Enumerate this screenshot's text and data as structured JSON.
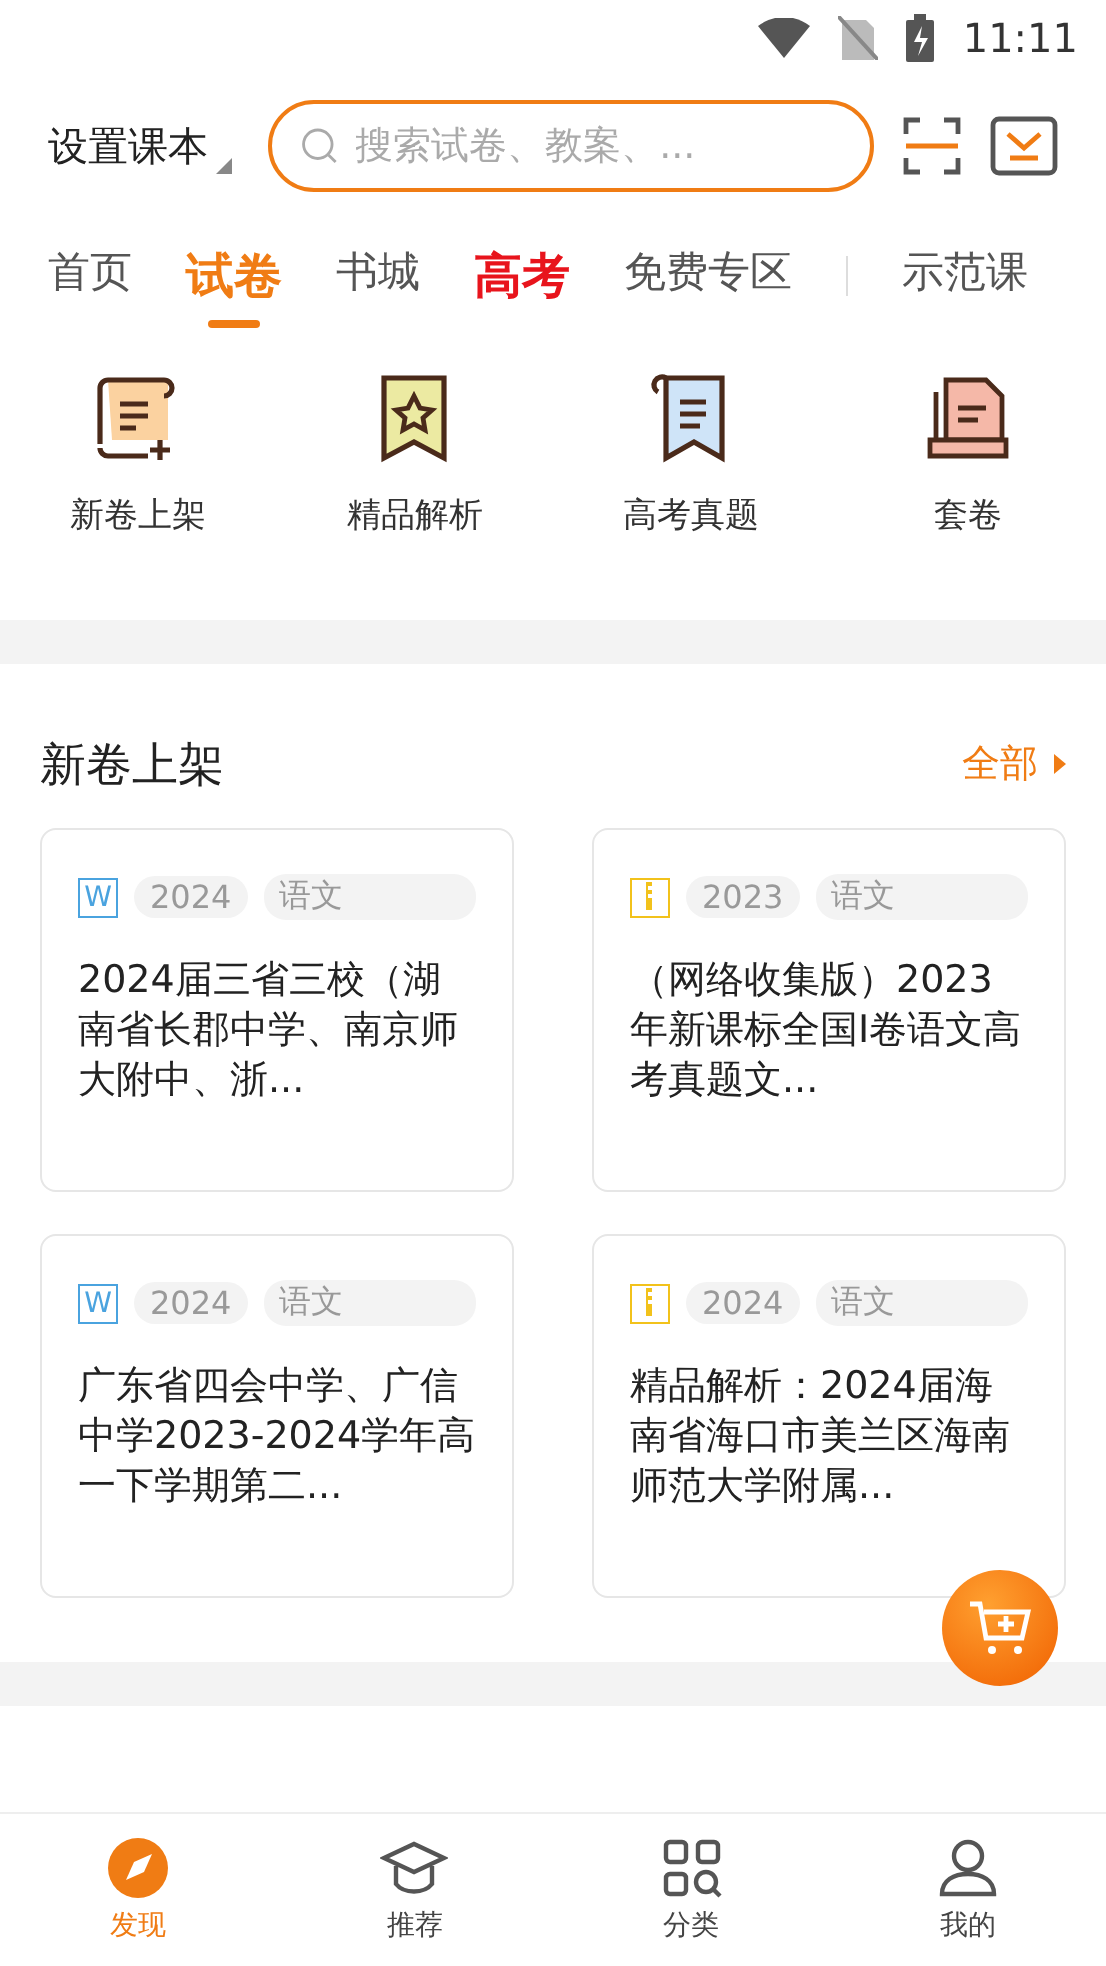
{
  "status_bar": {
    "time": "11:11"
  },
  "header": {
    "textbook": "设置课本",
    "search": {
      "placeholder": "搜索试卷、教案、..."
    }
  },
  "tabs": [
    {
      "label": "首页",
      "selected": false,
      "emphasis": false
    },
    {
      "label": "试卷",
      "selected": true,
      "emphasis": false
    },
    {
      "label": "书城",
      "selected": false,
      "emphasis": false
    },
    {
      "label": "高考",
      "selected": false,
      "emphasis": true
    },
    {
      "label": "免费专区",
      "selected": false,
      "emphasis": false
    },
    {
      "label": "示范课",
      "selected": false,
      "emphasis": false
    }
  ],
  "shortcuts": [
    {
      "label": "新卷上架",
      "kind": "new"
    },
    {
      "label": "精品解析",
      "kind": "star"
    },
    {
      "label": "高考真题",
      "kind": "exam"
    },
    {
      "label": "套卷",
      "kind": "set"
    }
  ],
  "sections": [
    {
      "title": "新卷上架",
      "more": "全部",
      "cards": [
        {
          "kind": "word",
          "file_badge": "W",
          "year": "2024",
          "subject": "语文",
          "title": "2024届三省三校（湖南省长郡中学、南京师大附中、浙..."
        },
        {
          "kind": "zip",
          "year": "2023",
          "subject": "语文",
          "title": "（网络收集版）2023年新课标全国I卷语文高考真题文..."
        },
        {
          "kind": "word",
          "file_badge": "W",
          "year": "2024",
          "subject": "语文",
          "title": "广东省四会中学、广信中学2023-2024学年高一下学期第二..."
        },
        {
          "kind": "zip",
          "year": "2024",
          "subject": "语文",
          "title": "精品解析：2024届海南省海口市美兰区海南师范大学附属..."
        }
      ]
    }
  ],
  "bottom_nav": [
    {
      "label": "发现",
      "kind": "discover",
      "selected": true
    },
    {
      "label": "推荐",
      "kind": "recommend",
      "selected": false
    },
    {
      "label": "分类",
      "kind": "category",
      "selected": false
    },
    {
      "label": "我的",
      "kind": "profile",
      "selected": false
    }
  ]
}
